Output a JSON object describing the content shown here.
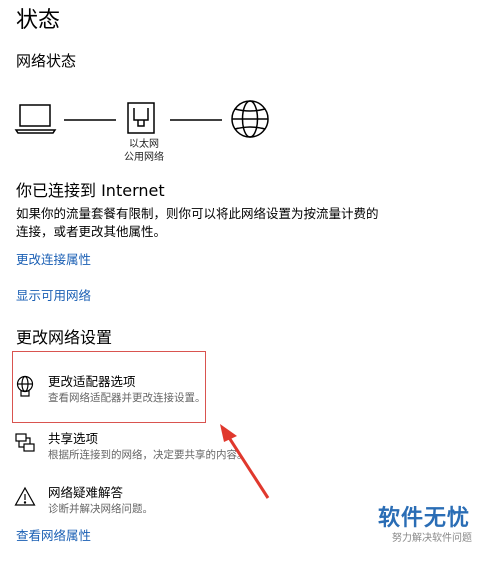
{
  "page": {
    "title": "状态"
  },
  "network_status": {
    "heading": "网络状态",
    "adapter_label_line1": "以太网",
    "adapter_label_line2": "公用网络"
  },
  "connection": {
    "title": "你已连接到 Internet",
    "description": "如果你的流量套餐有限制，则你可以将此网络设置为按流量计费的连接，或者更改其他属性。"
  },
  "links": {
    "change_connection_properties": "更改连接属性",
    "show_available_networks": "显示可用网络",
    "view_network_properties": "查看网络属性"
  },
  "change_settings": {
    "heading": "更改网络设置",
    "options": [
      {
        "title": "更改适配器选项",
        "description": "查看网络适配器并更改连接设置。",
        "icon": "adapter-globe-icon"
      },
      {
        "title": "共享选项",
        "description": "根据所连接到的网络，决定要共享的内容。",
        "icon": "sharing-icon"
      },
      {
        "title": "网络疑难解答",
        "description": "诊断并解决网络问题。",
        "icon": "warning-icon"
      }
    ]
  },
  "annotation": {
    "highlight_color": "#d9534f"
  },
  "watermark": {
    "main": "软件无忧",
    "sub": "努力解决软件问题"
  },
  "colors": {
    "link": "#1a5fb4",
    "text": "#000000"
  }
}
